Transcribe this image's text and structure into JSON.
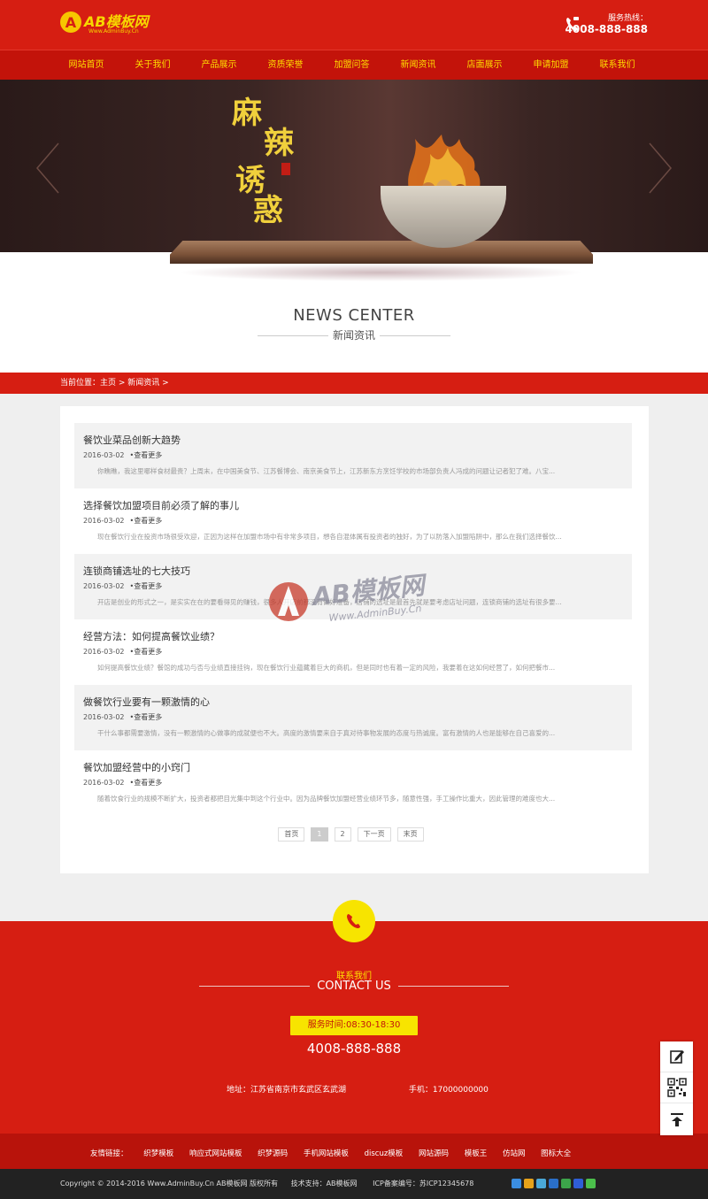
{
  "header": {
    "logo_text": "AB模板网",
    "logo_sub": "Www.AdminBuy.Cn",
    "hotline_label": "服务热线：",
    "hotline_number": "4008-888-888"
  },
  "nav": [
    {
      "label": "网站首页"
    },
    {
      "label": "关于我们"
    },
    {
      "label": "产品展示"
    },
    {
      "label": "资质荣誉"
    },
    {
      "label": "加盟问答"
    },
    {
      "label": "新闻资讯"
    },
    {
      "label": "店面展示"
    },
    {
      "label": "申请加盟"
    },
    {
      "label": "联系我们"
    }
  ],
  "banner": {
    "slogan": [
      "麻",
      "辣",
      "诱",
      "惑"
    ]
  },
  "section": {
    "title_en": "NEWS CENTER",
    "title_cn": "新闻资讯"
  },
  "breadcrumb": "当前位置：主页 > 新闻资讯 >",
  "news": [
    {
      "title": "餐饮业菜品创新大趋势",
      "date": "2016-03-02",
      "more": "•查看更多",
      "excerpt": "你瞧瞧，我这里哪样食材最贵？上周末，在中国美食节、江苏餐博会、南京美食节上，江苏新东方烹饪学校的市场部负责人冯成的问题让记者犯了难。八宝..."
    },
    {
      "title": "选择餐饮加盟项目前必须了解的事儿",
      "date": "2016-03-02",
      "more": "•查看更多",
      "excerpt": "现在餐饮行业在投资市场很受欢迎，正因为这样在加盟市场中有非常多项目，想各自混体属有投资者的独好，为了以防落入加盟陷阱中，那么在我们选择餐饮..."
    },
    {
      "title": "连锁商铺选址的七大技巧",
      "date": "2016-03-02",
      "more": "•查看更多",
      "excerpt": "开店是创业的形式之一，是实实在在的要看得见的赚钱，很多人开店前都没有做好准备，店铺的选址是最首先就是要考虑店址问题，连锁商铺的选址有很多要..."
    },
    {
      "title": "经营方法：如何提高餐饮业绩？",
      "date": "2016-03-02",
      "more": "•查看更多",
      "excerpt": "如何提高餐饮业绩？餐馆的成功与否与业绩直接挂钩，现在餐饮行业蕴藏着巨大的商机，但是同时也有着一定的风险，我要着在这如何经营了，如何把餐市..."
    },
    {
      "title": "做餐饮行业要有一颗激情的心",
      "date": "2016-03-02",
      "more": "•查看更多",
      "excerpt": "干什么事都需要激情，没有一颗激情的心做事的成就便也不大。高度的激情要来自于真对待事物发展的态度与热诚度。富有激情的人也是能够在自己喜爱的..."
    },
    {
      "title": "餐饮加盟经营中的小窍门",
      "date": "2016-03-02",
      "more": "•查看更多",
      "excerpt": "随着饮食行业的规模不断扩大，投资者都把目光集中到这个行业中。因为品牌餐饮加盟经营业绩环节多，随意性强，手工操作比重大，因此管理的难度也大..."
    }
  ],
  "pager": [
    "首页",
    "1",
    "2",
    "下一页",
    "末页"
  ],
  "watermark": {
    "text": "AB模板网",
    "sub": "Www.AdminBuy.Cn"
  },
  "contact": {
    "title_cn": "联系我们",
    "title_en": "CONTACT US",
    "hours": "服务时间:08:30-18:30",
    "phone": "4008-888-888",
    "address": "地址：江苏省南京市玄武区玄武湖",
    "mobile": "手机：17000000000"
  },
  "links": {
    "label": "友情链接：",
    "items": [
      "织梦模板",
      "响应式网站模板",
      "织梦源码",
      "手机网站模板",
      "discuz模板",
      "网站源码",
      "模板王",
      "仿站网",
      "图标大全"
    ]
  },
  "footer": {
    "copyright": "Copyright © 2014-2016 Www.AdminBuy.Cn AB模板网 版权所有",
    "tech": "技术支持：AB模板网",
    "icp": "ICP备案编号：苏ICP12345678"
  },
  "colors": {
    "brand_red": "#d61e12",
    "nav_red": "#c3130a",
    "accent_yellow": "#f7e400",
    "nav_text": "#ffde00"
  },
  "icons": {
    "side": [
      "edit-icon",
      "qrcode-icon",
      "back-to-top-icon"
    ],
    "share": [
      "qzone-icon",
      "weibo-icon",
      "tencent-weibo-icon",
      "renren-icon",
      "douban-icon",
      "baidu-icon",
      "wechat-icon"
    ]
  }
}
